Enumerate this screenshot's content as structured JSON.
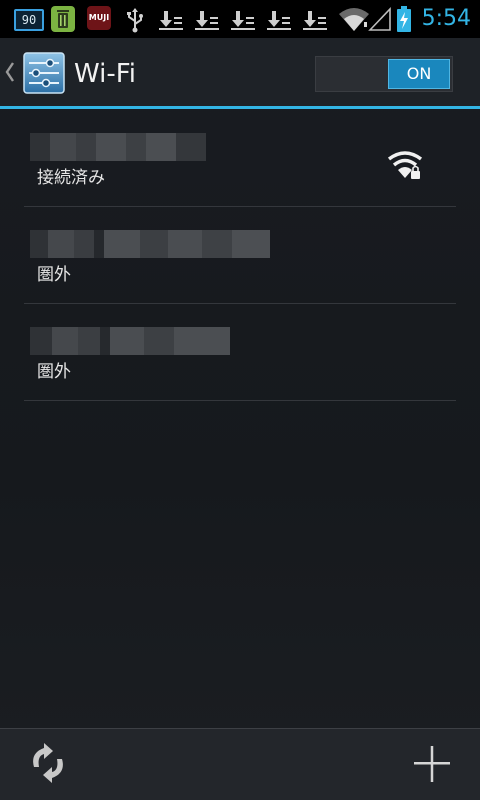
{
  "status_bar": {
    "notification_badge": "90",
    "app_label": "MUJI",
    "time": "5:54",
    "accent_color": "#33b5e5"
  },
  "action_bar": {
    "title": "Wi-Fi",
    "switch_label": "ON"
  },
  "networks": [
    {
      "status": "接続済み",
      "ssid_obscured": true,
      "signal_icon": "wifi-lock-icon"
    },
    {
      "status": "圏外",
      "ssid_obscured": true
    },
    {
      "status": "圏外",
      "ssid_obscured": true
    }
  ],
  "bottom_bar": {
    "scan_icon": "refresh-icon",
    "add_icon": "plus-icon"
  }
}
